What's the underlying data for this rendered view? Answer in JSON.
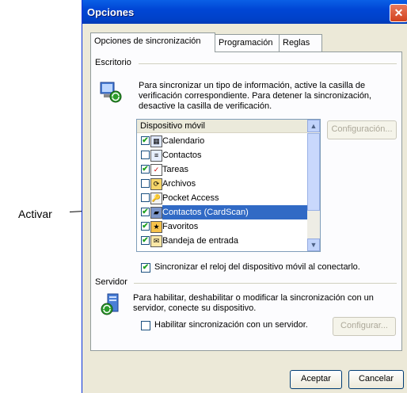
{
  "callout": {
    "label": "Activar"
  },
  "window": {
    "title": "Opciones",
    "close_glyph": "✕"
  },
  "tabs": [
    {
      "label": "Opciones de sincronización",
      "active": true
    },
    {
      "label": "Programación",
      "active": false
    },
    {
      "label": "Reglas",
      "active": false
    }
  ],
  "desktop": {
    "group_label": "Escritorio",
    "info_lines": [
      "Para sincronizar un tipo de información, active la casilla de",
      "verificación correspondiente. Para detener la sincronización,",
      "desactive la casilla de verificación."
    ],
    "list_header": "Dispositivo móvil",
    "items": [
      {
        "label": "Calendario",
        "checked": true,
        "icon": "calendar-icon",
        "selected": false
      },
      {
        "label": "Contactos",
        "checked": false,
        "icon": "contacts-icon",
        "selected": false
      },
      {
        "label": "Tareas",
        "checked": true,
        "icon": "tasks-icon",
        "selected": false
      },
      {
        "label": "Archivos",
        "checked": false,
        "icon": "files-icon",
        "selected": false
      },
      {
        "label": "Pocket Access",
        "checked": false,
        "icon": "pocket-access-icon",
        "selected": false
      },
      {
        "label": "Contactos (CardScan)",
        "checked": true,
        "icon": "cardscan-icon",
        "selected": true
      },
      {
        "label": "Favoritos",
        "checked": true,
        "icon": "favorites-icon",
        "selected": false
      },
      {
        "label": "Bandeja de entrada",
        "checked": true,
        "icon": "inbox-icon",
        "selected": false
      }
    ],
    "config_button": "Configuración...",
    "sync_clock_label": "Sincronizar el reloj del dispositivo móvil al conectarlo.",
    "sync_clock_checked": true
  },
  "server": {
    "group_label": "Servidor",
    "info_lines": [
      "Para habilitar, deshabilitar o modificar la sincronización con un",
      "servidor, conecte su dispositivo."
    ],
    "enable_label": "Habilitar sincronización con un servidor.",
    "enable_checked": false,
    "config_button": "Configurar..."
  },
  "buttons": {
    "ok": "Aceptar",
    "cancel": "Cancelar"
  },
  "colors": {
    "title_bar": "#0054e3",
    "selection": "#316ac5",
    "dialog_bg": "#ece9d8"
  }
}
